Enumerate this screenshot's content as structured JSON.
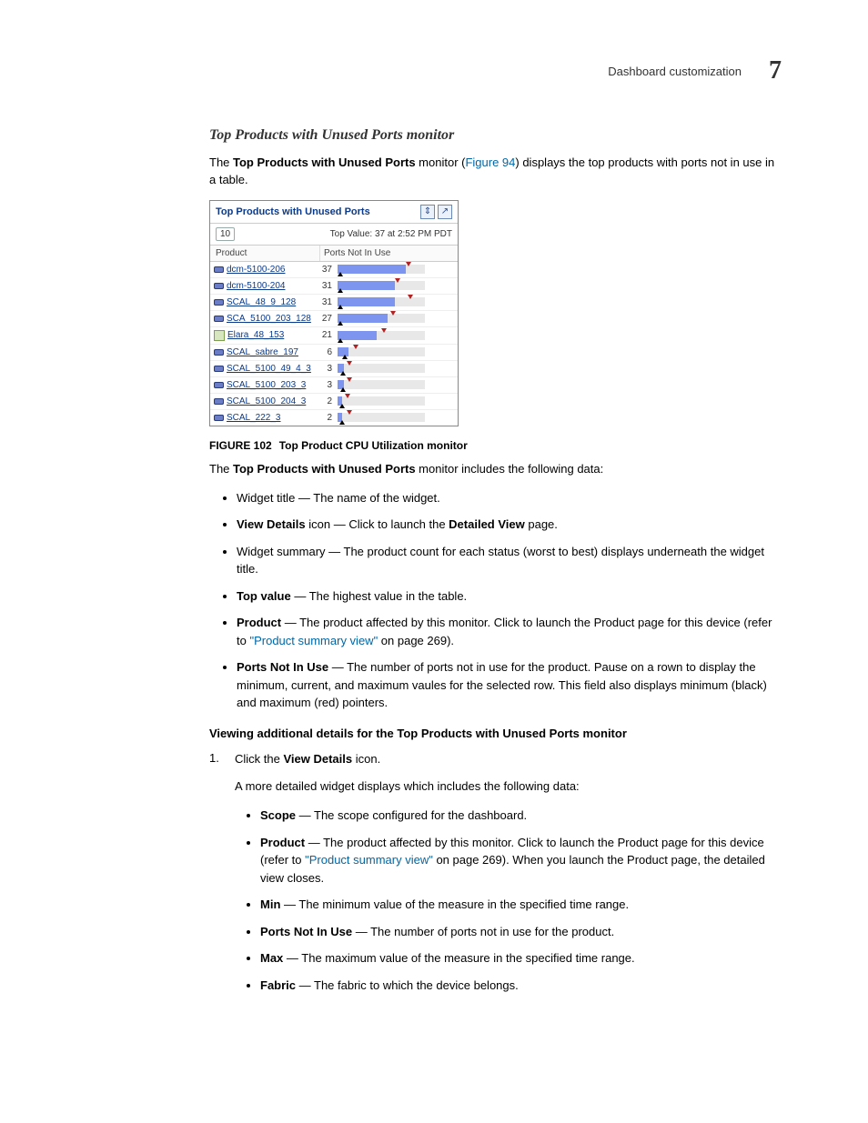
{
  "header": {
    "text": "Dashboard customization",
    "chapter": "7"
  },
  "section_title": "Top Products with Unused Ports monitor",
  "intro": {
    "pre": "The ",
    "b1": "Top Products with Unused Ports",
    "mid": " monitor (",
    "link": "Figure 94",
    "post": ") displays the top products with ports not in use in a table."
  },
  "widget": {
    "title": "Top Products with Unused Ports",
    "count": "10",
    "top_value": "Top Value: 37 at 2:52 PM PDT",
    "col_product": "Product",
    "col_ports": "Ports Not In Use",
    "rows": [
      {
        "name": "dcm-5100-206",
        "val": "37",
        "pct": 78,
        "max": 78,
        "min": 0,
        "icon": "switch"
      },
      {
        "name": "dcm-5100-204",
        "val": "31",
        "pct": 66,
        "max": 66,
        "min": 0,
        "icon": "switch"
      },
      {
        "name": "SCAL_48_9_128",
        "val": "31",
        "pct": 66,
        "max": 80,
        "min": 0,
        "icon": "switch"
      },
      {
        "name": "SCA_5100_203_128",
        "val": "27",
        "pct": 57,
        "max": 60,
        "min": 0,
        "icon": "switch"
      },
      {
        "name": "Elara_48_153",
        "val": "21",
        "pct": 45,
        "max": 50,
        "min": 0,
        "icon": "host"
      },
      {
        "name": "SCAL_sabre_197",
        "val": "6",
        "pct": 13,
        "max": 18,
        "min": 5,
        "icon": "switch"
      },
      {
        "name": "SCAL_5100_49_4_3",
        "val": "3",
        "pct": 7,
        "max": 10,
        "min": 3,
        "icon": "switch"
      },
      {
        "name": "SCAL_5100_203_3",
        "val": "3",
        "pct": 7,
        "max": 10,
        "min": 3,
        "icon": "switch"
      },
      {
        "name": "SCAL_5100_204_3",
        "val": "2",
        "pct": 5,
        "max": 8,
        "min": 2,
        "icon": "switch"
      },
      {
        "name": "SCAL_222_3",
        "val": "2",
        "pct": 5,
        "max": 10,
        "min": 2,
        "icon": "switch"
      }
    ]
  },
  "figure": {
    "label": "FIGURE 102",
    "caption": "Top Product CPU Utilization monitor"
  },
  "para2": {
    "pre": "The ",
    "b": "Top Products with Unused Ports",
    "post": " monitor includes the following data:"
  },
  "bullets1": [
    {
      "pre": "",
      "b": "",
      "body": "Widget title — The name of the widget."
    },
    {
      "pre": "",
      "b": "View Details",
      "body": " icon — Click to launch the ",
      "b2": "Detailed View",
      "body2": " page."
    },
    {
      "pre": "",
      "b": "",
      "body": "Widget summary — The product count for each status (worst to best) displays underneath the widget title."
    },
    {
      "pre": "",
      "b": "Top value",
      "body": " — The highest value in the table."
    },
    {
      "pre": "",
      "b": "Product",
      "body": " — The product affected by this monitor. Click to launch the Product page for this device (refer to ",
      "link": "\"Product summary view\"",
      "body2": " on page 269)."
    },
    {
      "pre": "",
      "b": "Ports Not In Use",
      "body": " — The number of ports not in use for the product. Pause on a rown to display the minimum, current, and maximum vaules for the selected row. This field also displays minimum (black) and maximum (red) pointers."
    }
  ],
  "subhead": "Viewing additional details for the Top Products with Unused Ports monitor",
  "step1": {
    "num": "1.",
    "pre": "Click the ",
    "b": "View Details",
    "post": " icon."
  },
  "step1_para": "A more detailed widget displays which includes the following data:",
  "bullets2": [
    {
      "b": "Scope",
      "body": " — The scope configured for the dashboard."
    },
    {
      "b": "Product",
      "body": " — The product affected by this monitor. Click to launch the Product page for this device (refer to ",
      "link": "\"Product summary view\"",
      "body2": " on page 269). When you launch the Product page, the detailed view closes."
    },
    {
      "b": "Min",
      "body": " — The minimum value of the measure in the specified time range."
    },
    {
      "b": "Ports Not In Use",
      "body": " — The number of ports not in use for the product."
    },
    {
      "b": "Max",
      "body": " — The maximum value of the measure in the specified time range."
    },
    {
      "b": "Fabric",
      "body": " — The fabric to which the device belongs."
    }
  ]
}
